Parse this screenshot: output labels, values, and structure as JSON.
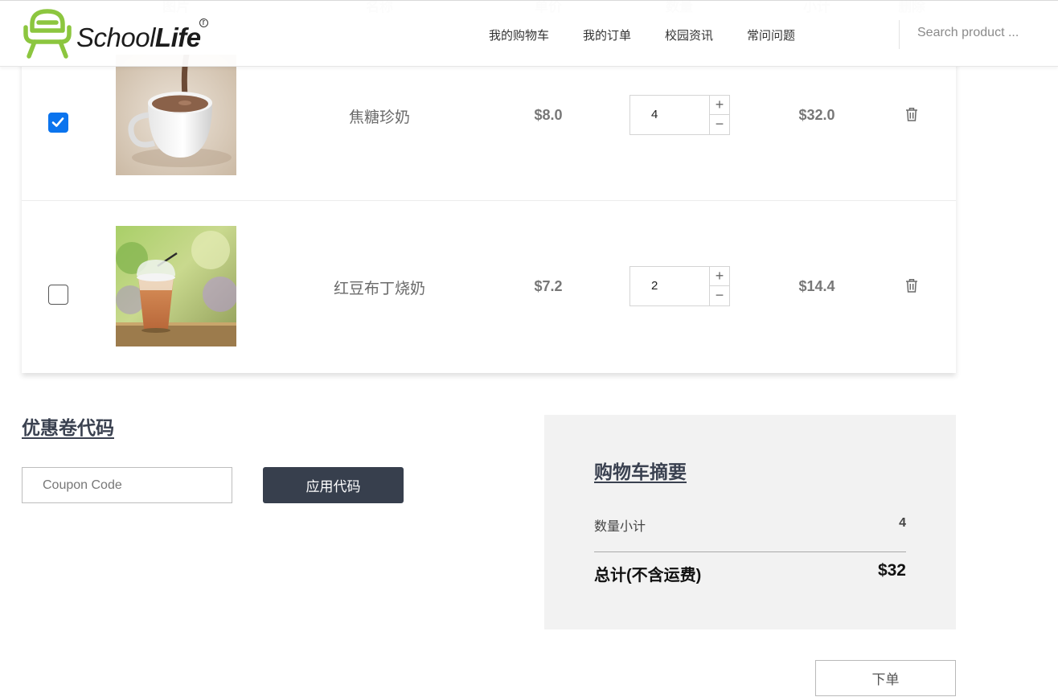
{
  "header": {
    "logo_text_1": "School",
    "logo_text_2": "Life",
    "nav": [
      "我的购物车",
      "我的订单",
      "校园资讯",
      "常问问题"
    ],
    "search_placeholder": "Search product ..."
  },
  "table": {
    "columns": [
      "图片",
      "名称",
      "单价",
      "数量",
      "小计",
      "删除"
    ],
    "rows": [
      {
        "checked": true,
        "name": "焦糖珍奶",
        "price": "$8.0",
        "qty": "4",
        "subtotal": "$32.0",
        "image": "hot-milk-tea-cup"
      },
      {
        "checked": false,
        "name": "红豆布丁烧奶",
        "price": "$7.2",
        "qty": "2",
        "subtotal": "$14.4",
        "image": "iced-milk-tea-cup"
      }
    ]
  },
  "coupon": {
    "title": "优惠卷代码",
    "placeholder": "Coupon Code",
    "apply_label": "应用代码"
  },
  "summary": {
    "title": "购物车摘要",
    "qty_label": "数量小计",
    "qty_value": "4",
    "total_label": "总计(不含运费)",
    "total_value": "$32"
  },
  "order_label": "下单",
  "colors": {
    "logo_green": "#8cc63f",
    "checkbox_blue": "#0b74ee",
    "button_dark": "#373f4d",
    "summary_bg": "#f2f2f2"
  }
}
